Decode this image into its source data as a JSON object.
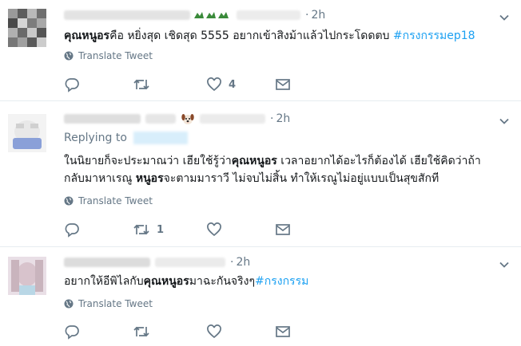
{
  "tweets": [
    {
      "time": "2h",
      "text_bold": "คุณหนูอร",
      "text_rest": "คือ หยิ่งสุด เชิดสุด 5555 อยากเข้าสิงม้าแล้วไปกระโดดตบ ",
      "hashtag": "#กรงกรรมep18",
      "translate": "Translate Tweet",
      "reply_count": "",
      "retweet_count": "",
      "like_count": "4"
    },
    {
      "time": "2h",
      "replying_label": "Replying to",
      "line1_a": "ในนิยายก็จะประมาณว่า เฮียใช้รู้ว่า",
      "line1_bold": "คุณหนูอร",
      "line1_b": " เวลาอยากได้อะไรก็ต้องได้ เฮียใช้คิดว่าถ้า",
      "line2_a": "กลับมาหาเรณู ",
      "line2_bold": "หนูอร",
      "line2_b": "จะตามมาราวี ไม่จบไม่สิ้น ทำให้เรณูไม่อยู่แบบเป็นสุขสักที",
      "translate": "Translate Tweet",
      "reply_count": "",
      "retweet_count": "1",
      "like_count": ""
    },
    {
      "time": "2h",
      "text_a": "อยากให้อีพิไลกับ",
      "text_bold": "คุณหนูอร",
      "text_b": "มาฉะกันจริงๆ",
      "hashtag": "#กรงกรรม",
      "translate": "Translate Tweet",
      "reply_count": "",
      "retweet_count": "",
      "like_count": ""
    }
  ],
  "colors": {
    "link": "#1da1f2",
    "muted": "#657786",
    "text": "#14171a",
    "divider": "#e6ecf0"
  },
  "icons": [
    "reply-icon",
    "retweet-icon",
    "like-icon",
    "direct-message-icon",
    "globe-icon",
    "chevron-down-icon"
  ]
}
